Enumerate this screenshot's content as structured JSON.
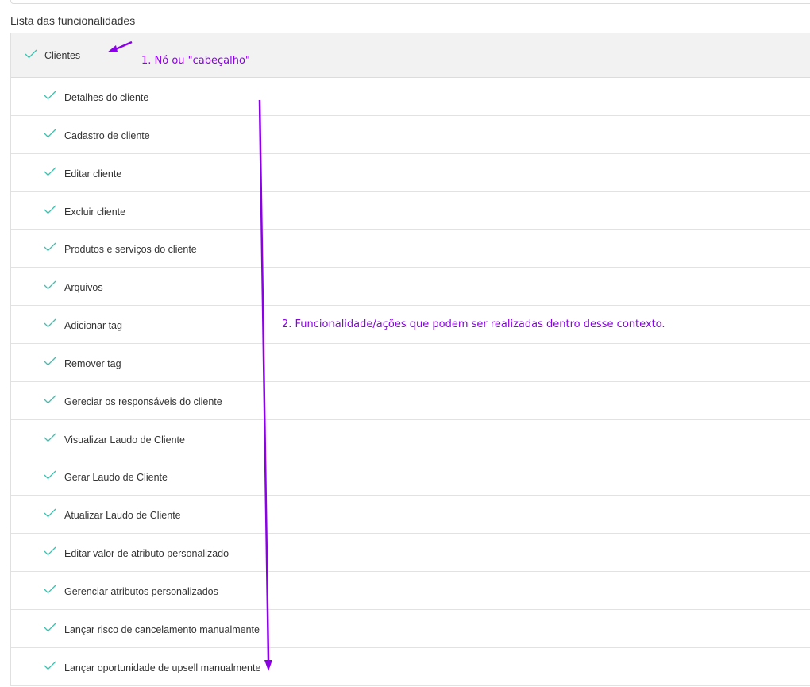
{
  "section": {
    "label": "Lista das funcionalidades"
  },
  "node": {
    "label": "Clientes",
    "checked": true
  },
  "features": [
    {
      "label": "Detalhes do cliente",
      "checked": true
    },
    {
      "label": "Cadastro de cliente",
      "checked": true
    },
    {
      "label": "Editar cliente",
      "checked": true
    },
    {
      "label": "Excluir cliente",
      "checked": true
    },
    {
      "label": "Produtos e serviços do cliente",
      "checked": true
    },
    {
      "label": "Arquivos",
      "checked": true
    },
    {
      "label": "Adicionar tag",
      "checked": true
    },
    {
      "label": "Remover tag",
      "checked": true
    },
    {
      "label": "Gereciar os responsáveis do cliente",
      "checked": true
    },
    {
      "label": "Visualizar Laudo de Cliente",
      "checked": true
    },
    {
      "label": "Gerar Laudo de Cliente",
      "checked": true
    },
    {
      "label": "Atualizar Laudo de Cliente",
      "checked": true
    },
    {
      "label": "Editar valor de atributo personalizado",
      "checked": true
    },
    {
      "label": "Gerenciar atributos personalizados",
      "checked": true
    },
    {
      "label": "Lançar risco de cancelamento manualmente",
      "checked": true
    },
    {
      "label": "Lançar oportunidade de upsell manualmente",
      "checked": true
    }
  ],
  "annotations": {
    "header_note": "1. Nó ou \"cabeçalho\"",
    "actions_note": "2. Funcionalidade/ações que podem ser realizadas dentro desse contexto."
  },
  "colors": {
    "check": "#3fbfad",
    "annotation": "#8b00e6",
    "header_bg": "#f2f2f2"
  },
  "icons": {
    "check": "check-icon",
    "arrow": "arrow-icon"
  }
}
